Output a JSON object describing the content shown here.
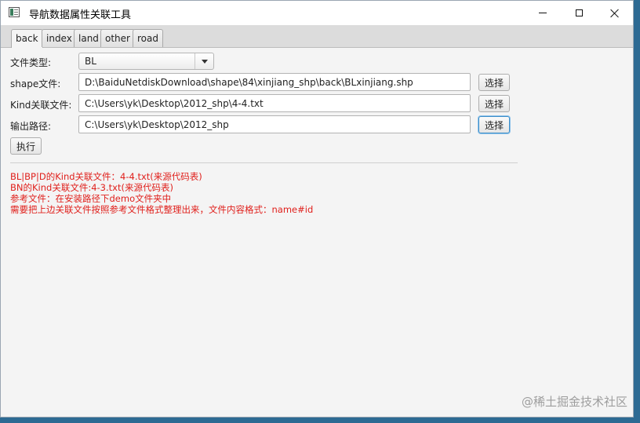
{
  "window": {
    "title": "导航数据属性关联工具"
  },
  "tabs": [
    {
      "label": "back",
      "active": true
    },
    {
      "label": "index",
      "active": false
    },
    {
      "label": "land",
      "active": false
    },
    {
      "label": "other",
      "active": false
    },
    {
      "label": "road",
      "active": false
    }
  ],
  "form": {
    "file_type": {
      "label": "文件类型:",
      "value": "BL"
    },
    "shape_file": {
      "label": "shape文件:",
      "value": "D:\\BaiduNetdiskDownload\\shape\\84\\xinjiang_shp\\back\\BLxinjiang.shp",
      "button": "选择"
    },
    "kind_file": {
      "label": "Kind关联文件:",
      "value": "C:\\Users\\yk\\Desktop\\2012_shp\\4-4.txt",
      "button": "选择"
    },
    "output_path": {
      "label": "输出路径:",
      "value": "C:\\Users\\yk\\Desktop\\2012_shp",
      "button": "选择"
    },
    "execute_button": "执行"
  },
  "notes": [
    "BL|BP|D的Kind关联文件：4-4.txt(来源代码表)",
    "BN的Kind关联文件:4-3.txt(来源代码表)",
    "参考文件：在安装路径下demo文件夹中",
    "需要把上边关联文件按照参考文件格式整理出来，文件内容格式：name#id"
  ],
  "watermark": "@稀土掘金技术社区",
  "colors": {
    "note_text": "#e0201c",
    "focus_border": "#3c8ec9"
  }
}
